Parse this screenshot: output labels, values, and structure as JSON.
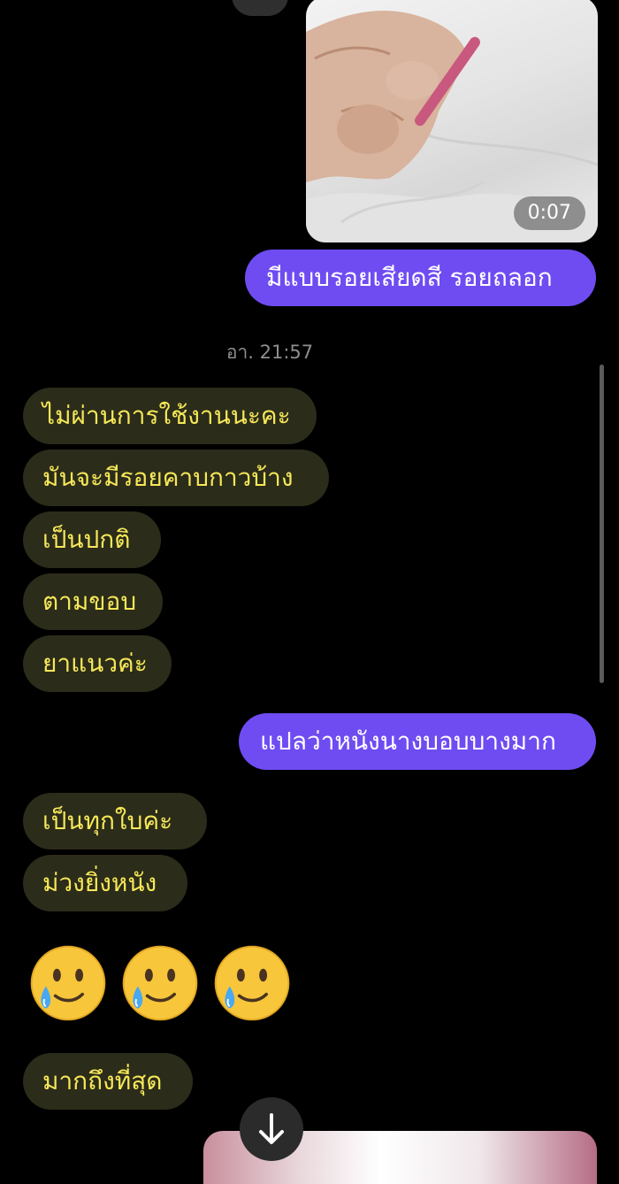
{
  "chat": {
    "video_message": {
      "duration": "0:07"
    },
    "outgoing_messages": [
      "มีแบบรอยเสียดสี รอยถลอก",
      "แปลว่าหนังนางบอบบางมาก"
    ],
    "timestamp": "อา. 21:57",
    "incoming_group_1": [
      "ไม่ผ่านการใช้งานนะคะ",
      "มันจะมีรอยคาบกาวบ้าง",
      "เป็นปกติ",
      "ตามขอบ",
      "ยาแนวค่ะ"
    ],
    "incoming_group_2": [
      "เป็นทุกใบค่ะ",
      "ม่วงยิ่งหนัง"
    ],
    "emoji_message": {
      "emojis": [
        "smiling-face-with-tear",
        "smiling-face-with-tear",
        "smiling-face-with-tear"
      ]
    },
    "incoming_group_3": [
      "มากถึงที่สุด"
    ]
  },
  "colors": {
    "background": "#000000",
    "outgoing_bubble": "#6f4cf2",
    "outgoing_text": "#ffffff",
    "incoming_bubble": "#2c2c1a",
    "incoming_text": "#f6e858",
    "timestamp_text": "#8e8e8e"
  },
  "icons": {
    "scroll_down": "arrow-down-icon"
  }
}
